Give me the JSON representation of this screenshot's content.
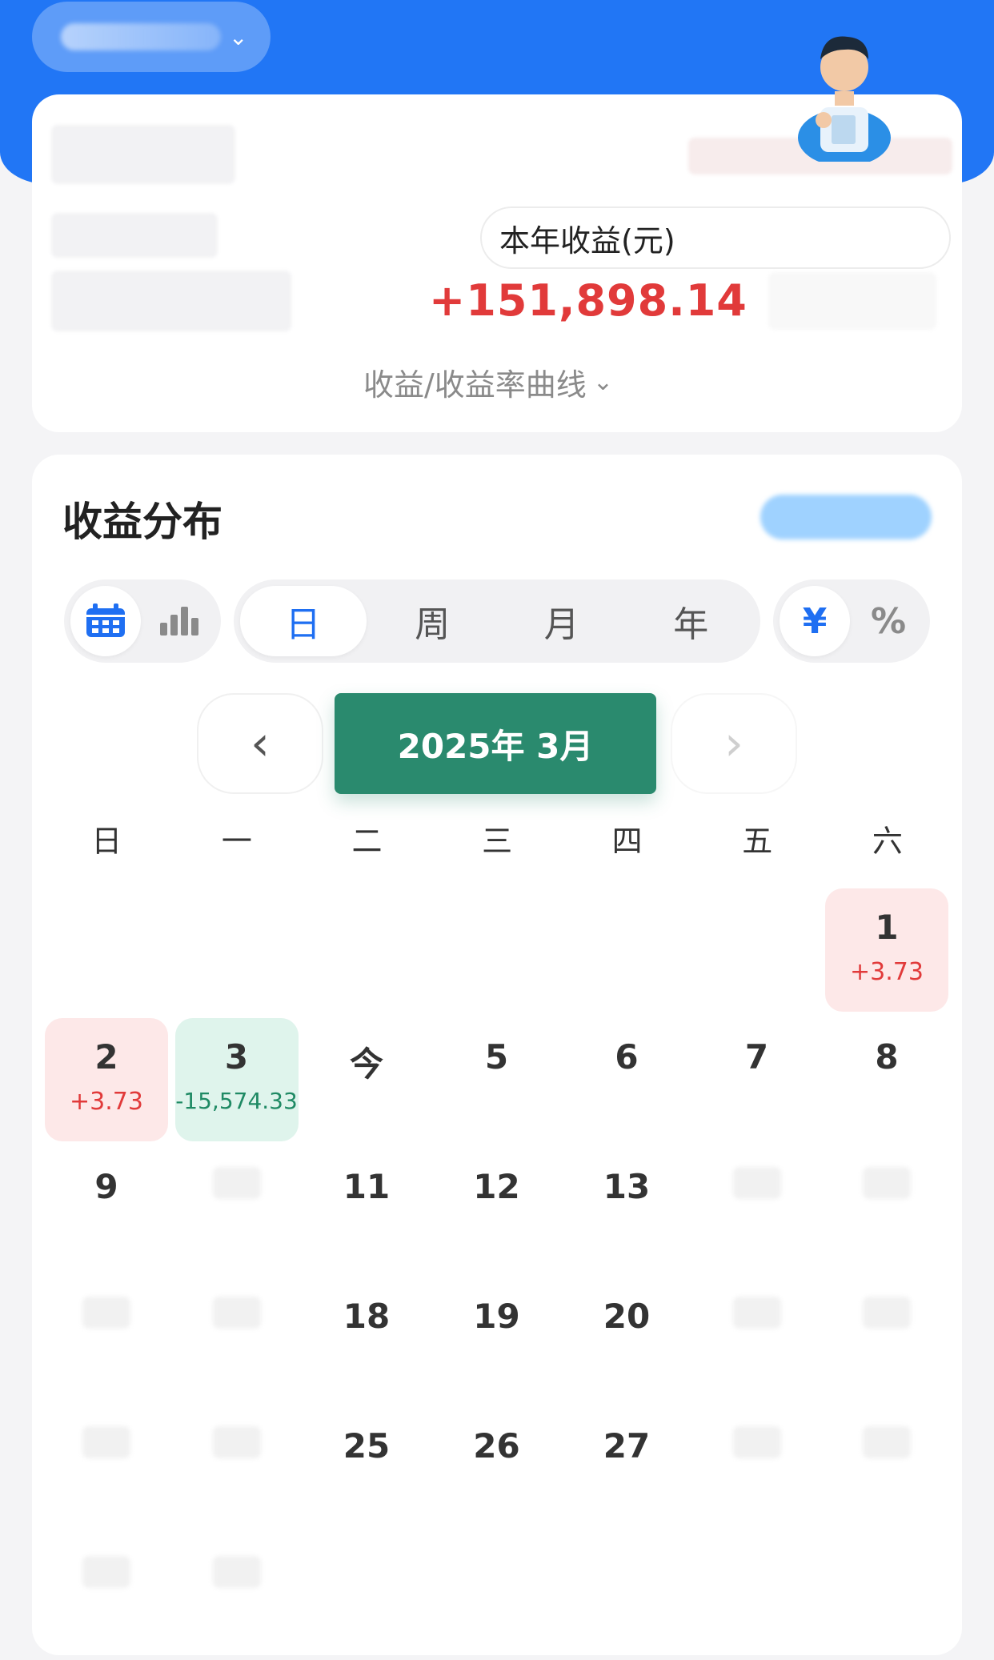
{
  "header": {
    "account_chevron": "⌄"
  },
  "summary": {
    "year_label": "本年收益(元)",
    "year_profit": "+151,898.14",
    "curve_toggle": "收益/收益率曲线",
    "curve_chevron": "⌄"
  },
  "section": {
    "title": "收益分布"
  },
  "segments": {
    "period": [
      "日",
      "周",
      "月",
      "年"
    ],
    "unit": [
      "¥",
      "%"
    ]
  },
  "month_nav": {
    "label": "2025年 3月",
    "prev": "‹",
    "next": "›"
  },
  "weekdays": [
    "日",
    "一",
    "二",
    "三",
    "四",
    "五",
    "六"
  ],
  "calendar": [
    {
      "day": "",
      "amount": "",
      "state": "empty"
    },
    {
      "day": "",
      "amount": "",
      "state": "empty"
    },
    {
      "day": "",
      "amount": "",
      "state": "empty"
    },
    {
      "day": "",
      "amount": "",
      "state": "empty"
    },
    {
      "day": "",
      "amount": "",
      "state": "empty"
    },
    {
      "day": "",
      "amount": "",
      "state": "empty"
    },
    {
      "day": "1",
      "amount": "+3.73",
      "state": "pos"
    },
    {
      "day": "2",
      "amount": "+3.73",
      "state": "pos"
    },
    {
      "day": "3",
      "amount": "-15,574.33",
      "state": "neg"
    },
    {
      "day": "今",
      "amount": "",
      "state": "plain"
    },
    {
      "day": "5",
      "amount": "",
      "state": "plain"
    },
    {
      "day": "6",
      "amount": "",
      "state": "plain"
    },
    {
      "day": "7",
      "amount": "",
      "state": "plain"
    },
    {
      "day": "8",
      "amount": "",
      "state": "plain"
    },
    {
      "day": "9",
      "amount": "",
      "state": "plain"
    },
    {
      "day": "",
      "amount": "",
      "state": "blur"
    },
    {
      "day": "11",
      "amount": "",
      "state": "plain"
    },
    {
      "day": "12",
      "amount": "",
      "state": "plain"
    },
    {
      "day": "13",
      "amount": "",
      "state": "plain"
    },
    {
      "day": "",
      "amount": "",
      "state": "blur"
    },
    {
      "day": "",
      "amount": "",
      "state": "blur"
    },
    {
      "day": "",
      "amount": "",
      "state": "blur"
    },
    {
      "day": "",
      "amount": "",
      "state": "blur"
    },
    {
      "day": "18",
      "amount": "",
      "state": "plain"
    },
    {
      "day": "19",
      "amount": "",
      "state": "plain"
    },
    {
      "day": "20",
      "amount": "",
      "state": "plain"
    },
    {
      "day": "",
      "amount": "",
      "state": "blur"
    },
    {
      "day": "",
      "amount": "",
      "state": "blur"
    },
    {
      "day": "",
      "amount": "",
      "state": "blur"
    },
    {
      "day": "",
      "amount": "",
      "state": "blur"
    },
    {
      "day": "25",
      "amount": "",
      "state": "plain"
    },
    {
      "day": "26",
      "amount": "",
      "state": "plain"
    },
    {
      "day": "27",
      "amount": "",
      "state": "plain"
    },
    {
      "day": "",
      "amount": "",
      "state": "blur"
    },
    {
      "day": "",
      "amount": "",
      "state": "blur"
    },
    {
      "day": "",
      "amount": "",
      "state": "blur"
    },
    {
      "day": "",
      "amount": "",
      "state": "blur"
    }
  ],
  "colors": {
    "brand_blue": "#2176f5",
    "active_blue": "#1f6ff2",
    "profit_red": "#e13a3a",
    "loss_green": "#1f8a64",
    "month_green": "#2a8a6e"
  }
}
